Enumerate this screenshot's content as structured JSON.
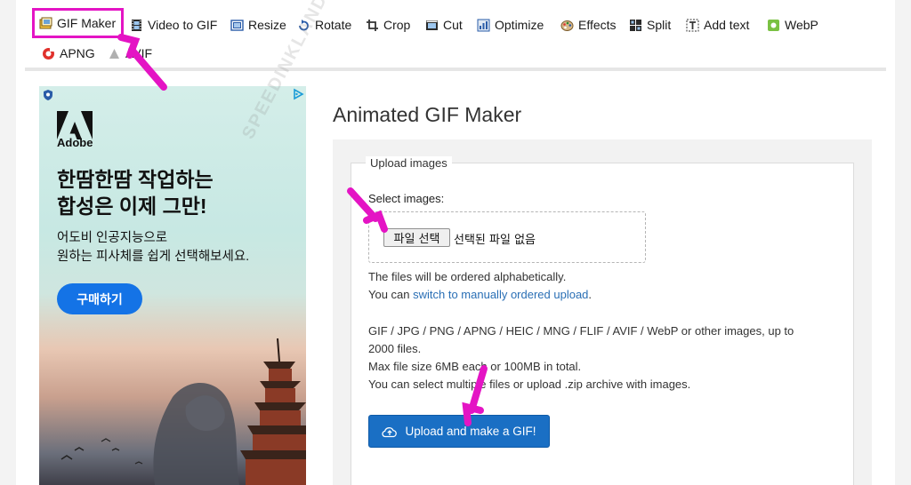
{
  "toolbar": {
    "items": [
      {
        "label": "GIF Maker",
        "icon": "gif-maker-icon",
        "active": true
      },
      {
        "label": "Video to GIF",
        "icon": "film-icon"
      },
      {
        "label": "Resize",
        "icon": "resize-icon"
      },
      {
        "label": "Rotate",
        "icon": "rotate-icon"
      },
      {
        "label": "Crop",
        "icon": "crop-icon"
      },
      {
        "label": "Cut",
        "icon": "cut-icon"
      },
      {
        "label": "Optimize",
        "icon": "optimize-icon"
      },
      {
        "label": "Effects",
        "icon": "effects-icon"
      },
      {
        "label": "Split",
        "icon": "split-icon"
      },
      {
        "label": "Add text",
        "icon": "add-text-icon"
      },
      {
        "label": "WebP",
        "icon": "webp-icon"
      },
      {
        "label": "APNG",
        "icon": "apng-icon"
      },
      {
        "label": "AVIF",
        "icon": "avif-icon"
      }
    ]
  },
  "ad": {
    "brand": "Adobe",
    "headline": "한땀한땀 작업하는\n합성은 이제 그만!",
    "sub": "어도비 인공지능으로\n원하는 피사체를 쉽게 선택해보세요.",
    "cta": "구매하기"
  },
  "main": {
    "title": "Animated GIF Maker",
    "fieldset_legend": "Upload images",
    "select_label": "Select images:",
    "file_button": "파일 선택",
    "file_status": "선택된 파일 없음",
    "order_note": "The files will be ordered alphabetically.",
    "manual_prefix": "You can ",
    "manual_link": "switch to manually ordered upload",
    "manual_suffix": ".",
    "formats_line1": "GIF / JPG / PNG / APNG / HEIC / MNG / FLIF / AVIF / WebP or other images, up to",
    "formats_line2": "2000 files.",
    "max_size": "Max file size 6MB each or 100MB in total.",
    "zip_note": "You can select multiple files or upload .zip archive with images.",
    "upload_button": "Upload and make a GIF!"
  },
  "watermark": "SPEEDINKLAND.COM",
  "colors": {
    "highlight": "#e414c4",
    "primary": "#1a6fc4",
    "link": "#2a6fb5",
    "adobe_blue": "#1473e6"
  }
}
